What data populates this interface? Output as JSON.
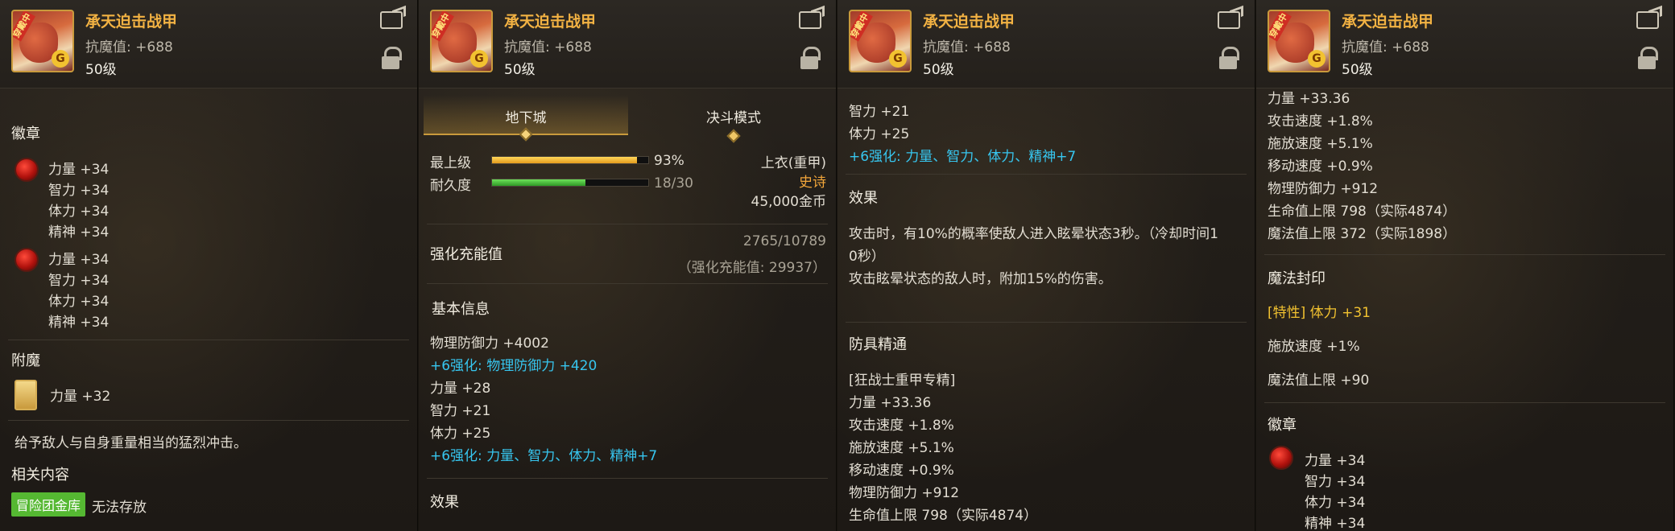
{
  "item": {
    "name": "承天迫击战甲",
    "resist": "抗魔值: +688",
    "level": "50级",
    "ribbon": "穿戴中"
  },
  "panel1": {
    "tabs": [
      "地下城",
      "决斗模式"
    ],
    "grade_label": "最上级",
    "grade_value": "93%",
    "grade_fill": 0.93,
    "durability_label": "耐久度",
    "durability_value": "18/30",
    "durability_fill": 0.6,
    "slot": "上衣(重甲)",
    "rarity": "史诗",
    "price": "45,000金币",
    "charge_label": "强化充能值",
    "charge_value": "2765/10789",
    "charge_detail": "（强化充能值: 29937）",
    "basic_info_title": "基本信息",
    "lines": [
      {
        "text": "物理防御力 +4002",
        "color": "white"
      },
      {
        "text": "+6强化: 物理防御力 +420",
        "color": "cyan"
      },
      {
        "text": "力量 +28",
        "color": "white"
      },
      {
        "text": "智力 +21",
        "color": "white"
      },
      {
        "text": "体力 +25",
        "color": "white"
      },
      {
        "text": "+6强化: 力量、智力、体力、精神+7",
        "color": "cyan"
      }
    ],
    "effect_title": "效果"
  },
  "panel2": {
    "top_lines": [
      "智力 +21",
      "体力 +25"
    ],
    "top_cyan": "+6强化: 力量、智力、体力、精神+7",
    "effect_title": "效果",
    "effect_text": [
      "攻击时，有10%的概率使敌人进入眩晕状态3秒。（冷却时间1",
      "0秒）",
      "攻击眩晕状态的敌人时，附加15%的伤害。"
    ],
    "mastery_title": "防具精通",
    "mastery_sub": "[狂战士重甲专精]",
    "mastery_lines": [
      "力量 +33.36",
      "攻击速度 +1.8%",
      "施放速度 +5.1%",
      "移动速度 +0.9%",
      "物理防御力 +912",
      "生命值上限 798（实际4874）"
    ]
  },
  "panel3": {
    "top_lines": [
      "力量 +33.36",
      "攻击速度 +1.8%",
      "施放速度 +5.1%",
      "移动速度 +0.9%",
      "物理防御力 +912",
      "生命值上限 798（实际4874）",
      "魔法值上限 372（实际1898）"
    ],
    "seal_title": "魔法封印",
    "seal_special": "[特性] 体力 +31",
    "seal_lines": [
      "施放速度 +1%",
      "魔法值上限 +90"
    ],
    "emblem_title": "徽章",
    "emblem_lines": [
      "力量 +34",
      "智力 +34",
      "体力 +34",
      "精神 +34"
    ]
  },
  "panel4": {
    "emblem_title": "徽章",
    "emblem1": [
      "力量 +34",
      "智力 +34",
      "体力 +34",
      "精神 +34"
    ],
    "emblem2": [
      "力量 +34",
      "智力 +34",
      "体力 +34",
      "精神 +34"
    ],
    "enchant_title": "附魔",
    "enchant_value": "力量 +32",
    "flavor": "给予敌人与自身重量相当的猛烈冲击。",
    "related_title": "相关内容",
    "related_tag": "冒险团金库",
    "related_text": "无法存放"
  }
}
